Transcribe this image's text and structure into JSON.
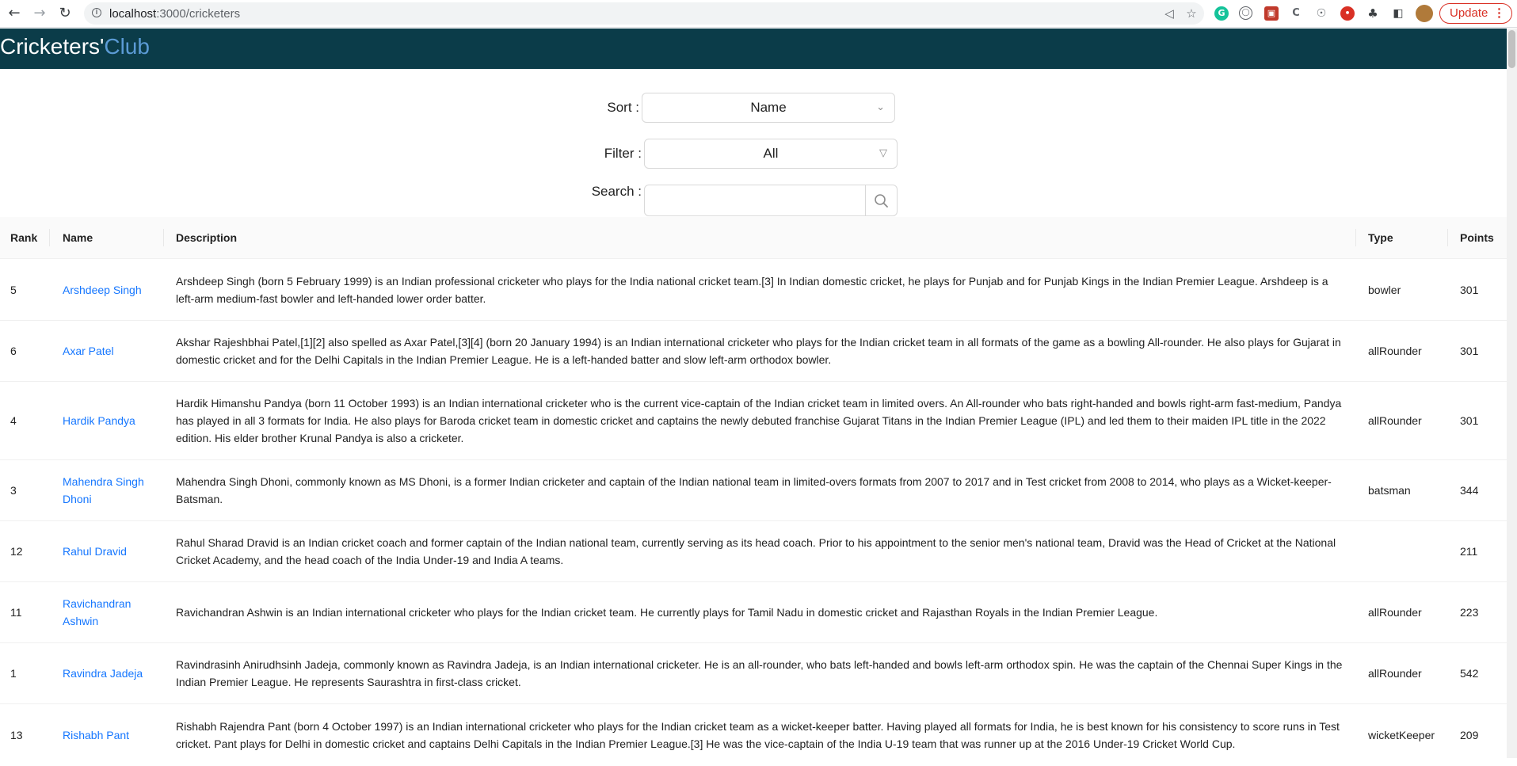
{
  "browser": {
    "url_host": "localhost",
    "url_path": ":3000/cricketers",
    "update_label": "Update"
  },
  "header": {
    "brand_main": "Cricketers'",
    "brand_accent": "Club"
  },
  "controls": {
    "sort_label": "Sort :",
    "sort_value": "Name",
    "filter_label": "Filter :",
    "filter_value": "All",
    "search_label": "Search :",
    "search_value": ""
  },
  "table": {
    "columns": [
      "Rank",
      "Name",
      "Description",
      "Type",
      "Points"
    ],
    "rows": [
      {
        "rank": "5",
        "name": "Arshdeep Singh",
        "description": "Arshdeep Singh (born 5 February 1999) is an Indian professional cricketer who plays for the India national cricket team.[3] In Indian domestic cricket, he plays for Punjab and for Punjab Kings in the Indian Premier League. Arshdeep is a left-arm medium-fast bowler and left-handed lower order batter.",
        "type": "bowler",
        "points": "301"
      },
      {
        "rank": "6",
        "name": "Axar Patel",
        "description": "Akshar Rajeshbhai Patel,[1][2] also spelled as Axar Patel,[3][4] (born 20 January 1994) is an Indian international cricketer who plays for the Indian cricket team in all formats of the game as a bowling All-rounder. He also plays for Gujarat in domestic cricket and for the Delhi Capitals in the Indian Premier League. He is a left-handed batter and slow left-arm orthodox bowler.",
        "type": "allRounder",
        "points": "301"
      },
      {
        "rank": "4",
        "name": "Hardik Pandya",
        "description": "Hardik Himanshu Pandya (born 11 October 1993) is an Indian international cricketer who is the current vice-captain of the Indian cricket team in limited overs. An All-rounder who bats right-handed and bowls right-arm fast-medium, Pandya has played in all 3 formats for India. He also plays for Baroda cricket team in domestic cricket and captains the newly debuted franchise Gujarat Titans in the Indian Premier League (IPL) and led them to their maiden IPL title in the 2022 edition. His elder brother Krunal Pandya is also a cricketer.",
        "type": "allRounder",
        "points": "301"
      },
      {
        "rank": "3",
        "name": "Mahendra Singh Dhoni",
        "description": "Mahendra Singh Dhoni, commonly known as MS Dhoni, is a former Indian cricketer and captain of the Indian national team in limited-overs formats from 2007 to 2017 and in Test cricket from 2008 to 2014, who plays as a Wicket-keeper-Batsman.",
        "type": "batsman",
        "points": "344"
      },
      {
        "rank": "12",
        "name": "Rahul Dravid",
        "description": "Rahul Sharad Dravid is an Indian cricket coach and former captain of the Indian national team, currently serving as its head coach. Prior to his appointment to the senior men's national team, Dravid was the Head of Cricket at the National Cricket Academy, and the head coach of the India Under-19 and India A teams.",
        "type": "",
        "points": "211"
      },
      {
        "rank": "11",
        "name": "Ravichandran Ashwin",
        "description": "Ravichandran Ashwin is an Indian international cricketer who plays for the Indian cricket team. He currently plays for Tamil Nadu in domestic cricket and Rajasthan Royals in the Indian Premier League.",
        "type": "allRounder",
        "points": "223"
      },
      {
        "rank": "1",
        "name": "Ravindra Jadeja",
        "description": "Ravindrasinh Anirudhsinh Jadeja, commonly known as Ravindra Jadeja, is an Indian international cricketer. He is an all-rounder, who bats left-handed and bowls left-arm orthodox spin. He was the captain of the Chennai Super Kings in the Indian Premier League. He represents Saurashtra in first-class cricket.",
        "type": "allRounder",
        "points": "542"
      },
      {
        "rank": "13",
        "name": "Rishabh Pant",
        "description": "Rishabh Rajendra Pant (born 4 October 1997) is an Indian international cricketer who plays for the Indian cricket team as a wicket-keeper batter. Having played all formats for India, he is best known for his consistency to score runs in Test cricket. Pant plays for Delhi in domestic cricket and captains Delhi Capitals in the Indian Premier League.[3] He was the vice-captain of the India U-19 team that was runner up at the 2016 Under-19 Cricket World Cup.",
        "type": "wicketKeeper",
        "points": "209"
      }
    ]
  },
  "colors": {
    "header_bg": "#0b3c49",
    "brand_accent": "#5b9bd5",
    "link": "#1677ff"
  }
}
